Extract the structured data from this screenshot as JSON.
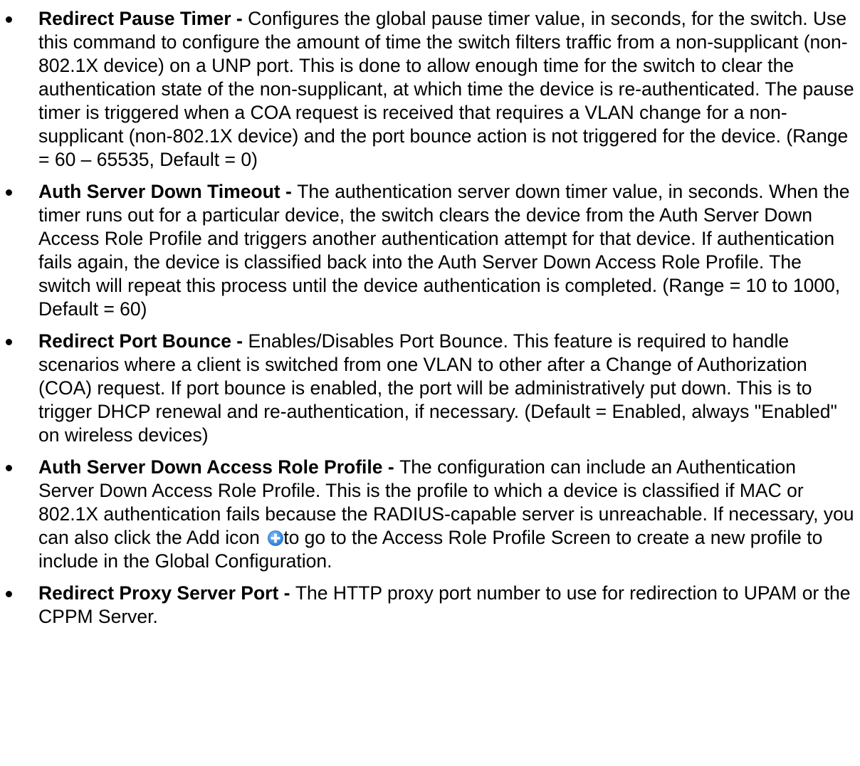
{
  "items": [
    {
      "term": "Redirect Pause Timer -",
      "text": "Configures the global pause timer value, in seconds, for the switch. Use this command to configure the amount of time the switch filters traffic from a non-supplicant (non-802.1X device) on a UNP port. This is done to allow enough time for the switch to clear the authentication state of the non-supplicant, at which time the device is re-authenticated. The pause timer is triggered when a COA request is received that requires a VLAN change for a non-supplicant (non-802.1X device) and the port bounce action is not triggered for the device. (Range = 60 – 65535, Default = 0)"
    },
    {
      "term": "Auth Server Down Timeout -",
      "text": "The authentication server down timer value, in seconds. When the timer runs out for a particular device, the switch clears the device from the Auth Server Down Access Role Profile and triggers another authentication attempt for that device. If authentication fails again, the device is classified back into the Auth Server Down Access Role Profile. The switch will repeat this process until the device authentication is completed. (Range = 10 to 1000, Default = 60)"
    },
    {
      "term": "Redirect Port Bounce -",
      "text": "Enables/Disables Port Bounce. This feature is required to handle scenarios where a client is switched from one VLAN to other after a Change of Authorization (COA) request. If port bounce is enabled, the port will be administratively put down. This is to trigger DHCP renewal and re-authentication, if necessary. (Default = Enabled, always \"Enabled\" on wireless devices)"
    },
    {
      "term": "Auth Server Down Access Role Profile -",
      "text_before_icon": "The configuration can include an Authentication Server Down Access Role Profile. This is the profile to which a device is classified if MAC or 802.1X authentication fails because the RADIUS-capable server is unreachable. If necessary, you can also click the Add icon",
      "icon": "add-circle-icon",
      "text_after_icon": "to go to the Access Role Profile Screen to create a new profile to include in the Global Configuration."
    },
    {
      "term": "Redirect Proxy Server Port -",
      "text": "The HTTP proxy port number to use for redirection to UPAM or the CPPM Server."
    }
  ],
  "colors": {
    "text": "#000000",
    "add_icon_fill": "#3d8fe0",
    "add_icon_plus": "#ffffff"
  }
}
